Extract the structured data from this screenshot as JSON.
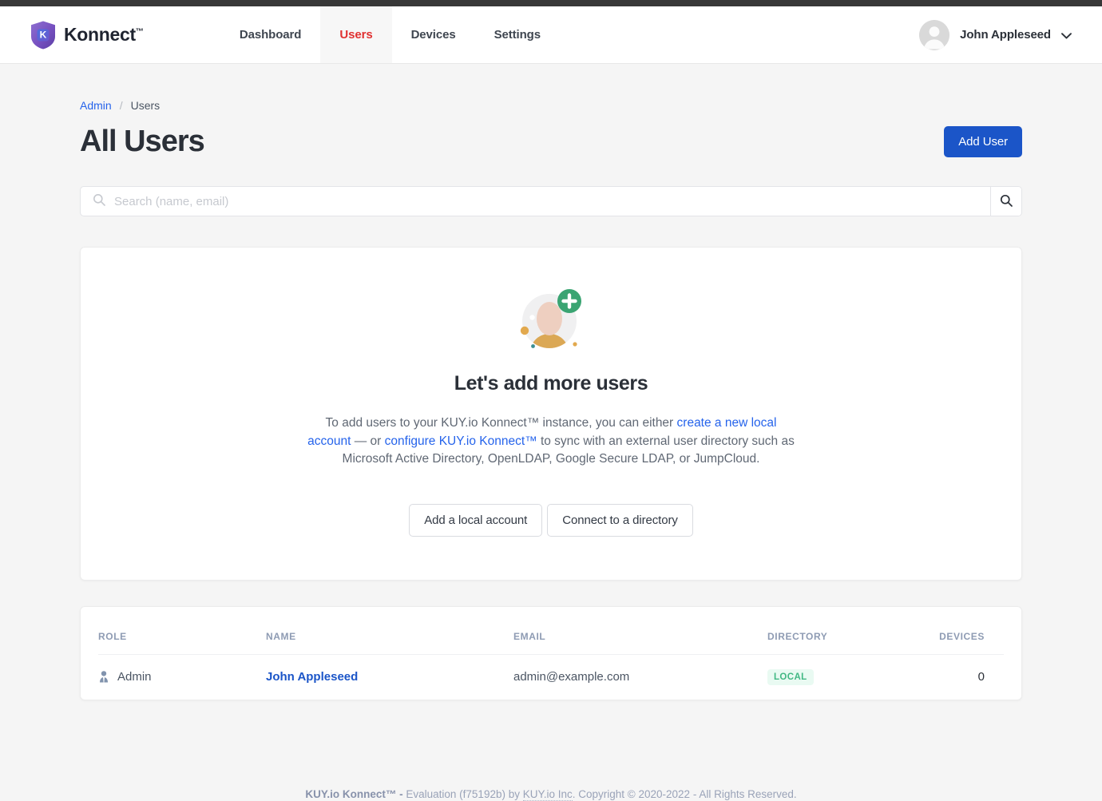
{
  "brand": {
    "name": "Konnect",
    "tm": "™",
    "logo_icon": "shield-k-logo"
  },
  "nav": {
    "items": [
      {
        "label": "Dashboard",
        "active": false
      },
      {
        "label": "Users",
        "active": true
      },
      {
        "label": "Devices",
        "active": false
      },
      {
        "label": "Settings",
        "active": false
      }
    ]
  },
  "user_menu": {
    "name": "John Appleseed",
    "avatar_icon": "user-avatar-icon",
    "caret_icon": "chevron-down-icon"
  },
  "breadcrumb": {
    "root": "Admin",
    "separator": "/",
    "current": "Users"
  },
  "header": {
    "title": "All Users",
    "add_user_label": "Add User"
  },
  "search": {
    "placeholder": "Search (name, email)",
    "value": "",
    "icon": "search-icon",
    "button_icon": "search-icon"
  },
  "empty_state": {
    "illustration": "add-user-illustration",
    "title": "Let's add more users",
    "body_1": "To add users to your KUY.io Konnect™ instance, you can either ",
    "link_1": "create a new local account",
    "body_2": " — or ",
    "link_2": "configure KUY.io Konnect™",
    "body_3": " to sync with an external user directory such as Microsoft Active Directory, OpenLDAP, Google Secure LDAP, or JumpCloud.",
    "button_local": "Add a local account",
    "button_directory": "Connect to a directory"
  },
  "table": {
    "columns": [
      "ROLE",
      "NAME",
      "EMAIL",
      "DIRECTORY",
      "DEVICES"
    ],
    "rows": [
      {
        "role": "Admin",
        "role_icon": "user-tie-icon",
        "name": "John Appleseed",
        "email": "admin@example.com",
        "directory": "LOCAL",
        "devices": "0"
      }
    ]
  },
  "footer": {
    "product": "KUY.io Konnect™ -",
    "text_1": " Evaluation (f75192b) by ",
    "company": "KUY.io Inc",
    "text_2": ". Copyright © 2020-2022 - All Rights Reserved."
  },
  "colors": {
    "accent_blue": "#1b55c8",
    "link_blue": "#2563eb",
    "active_red": "#e03131",
    "badge_green": "#41b883",
    "badge_green_bg": "#e9faf2",
    "page_bg": "#f5f5f5",
    "top_strip": "#383838"
  }
}
